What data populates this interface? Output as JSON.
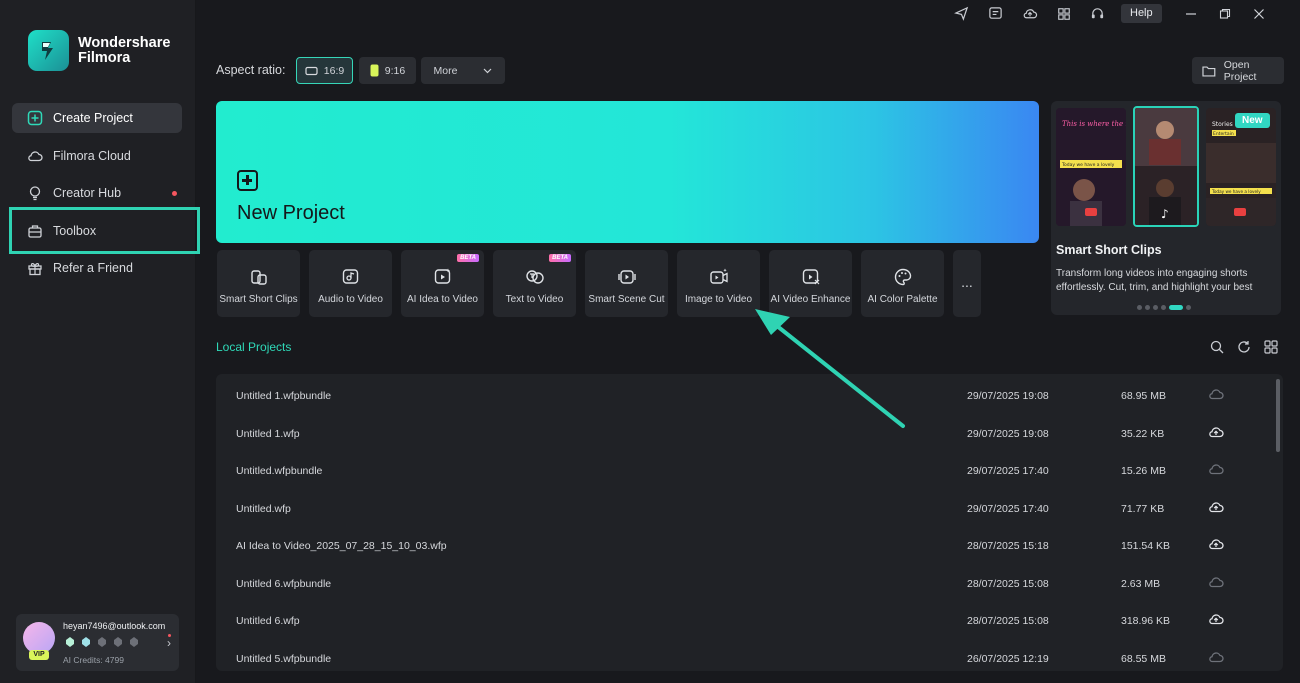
{
  "brand": {
    "line1": "Wondershare",
    "line2": "Filmora"
  },
  "sidebar": {
    "items": [
      {
        "label": "Create Project",
        "icon": "plus-square-icon",
        "active": true
      },
      {
        "label": "Filmora Cloud",
        "icon": "cloud-icon"
      },
      {
        "label": "Creator Hub",
        "icon": "lightbulb-icon",
        "dot": true
      },
      {
        "label": "Toolbox",
        "icon": "toolbox-icon",
        "highlighted": true
      },
      {
        "label": "Refer a Friend",
        "icon": "gift-icon"
      }
    ]
  },
  "user": {
    "email": "heyan7496@outlook.com",
    "credits": "AI Credits: 4799",
    "badge": "VIP",
    "arrow": "›"
  },
  "topbar": {
    "help": "Help"
  },
  "aspect": {
    "label": "Aspect ratio:",
    "r169": "16:9",
    "r916": "9:16",
    "more": "More"
  },
  "open_project": "Open Project",
  "new_project": {
    "title": "New Project"
  },
  "tools": [
    {
      "label": "Smart Short Clips",
      "icon": "smart-short-clips-icon",
      "beta": ""
    },
    {
      "label": "Audio to Video",
      "icon": "audio-to-video-icon",
      "beta": ""
    },
    {
      "label": "AI Idea to Video",
      "icon": "ai-idea-to-video-icon",
      "beta": "BETA"
    },
    {
      "label": "Text to Video",
      "icon": "text-to-video-icon",
      "beta": "BETA"
    },
    {
      "label": "Smart Scene Cut",
      "icon": "smart-scene-cut-icon",
      "beta": ""
    },
    {
      "label": "Image to Video",
      "icon": "image-to-video-icon",
      "beta": ""
    },
    {
      "label": "AI Video Enhance",
      "icon": "ai-video-enhance-icon",
      "beta": ""
    },
    {
      "label": "AI Color Palette",
      "icon": "ai-color-palette-icon",
      "beta": ""
    }
  ],
  "tools_more": "...",
  "promo": {
    "badge": "New",
    "title": "Smart Short Clips",
    "desc": "Transform long videos into engaging shorts effortlessly. Cut, trim, and highlight your best",
    "thumb1_text1": "This is where the magic happens",
    "thumb1_text2": "Today we have a lovely",
    "thumb3_text1": "Stories",
    "thumb3_text2": "Entertain",
    "thumb3_text3": "Today we have a lovely"
  },
  "local_projects": {
    "title": "Local Projects",
    "rows": [
      {
        "name": "Untitled 1.wfpbundle",
        "date": "29/07/2025 19:08",
        "size": "68.95 MB",
        "cloud": "cloud-synced-icon"
      },
      {
        "name": "Untitled 1.wfp",
        "date": "29/07/2025 19:08",
        "size": "35.22 KB",
        "cloud": "cloud-upload-icon"
      },
      {
        "name": "Untitled.wfpbundle",
        "date": "29/07/2025 17:40",
        "size": "15.26 MB",
        "cloud": "cloud-synced-icon"
      },
      {
        "name": "Untitled.wfp",
        "date": "29/07/2025 17:40",
        "size": "71.77 KB",
        "cloud": "cloud-upload-icon"
      },
      {
        "name": "AI Idea to Video_2025_07_28_15_10_03.wfp",
        "date": "28/07/2025 15:18",
        "size": "151.54 KB",
        "cloud": "cloud-upload-icon"
      },
      {
        "name": "Untitled 6.wfpbundle",
        "date": "28/07/2025 15:08",
        "size": "2.63 MB",
        "cloud": "cloud-synced-icon"
      },
      {
        "name": "Untitled 6.wfp",
        "date": "28/07/2025 15:08",
        "size": "318.96 KB",
        "cloud": "cloud-upload-icon"
      },
      {
        "name": "Untitled 5.wfpbundle",
        "date": "26/07/2025 12:19",
        "size": "68.55 MB",
        "cloud": "cloud-synced-icon"
      }
    ]
  },
  "colors": {
    "accent": "#2fd9b8",
    "annotation": "#2fd3b3",
    "sidebar_bg": "#1f2024",
    "bg": "#18191d"
  }
}
